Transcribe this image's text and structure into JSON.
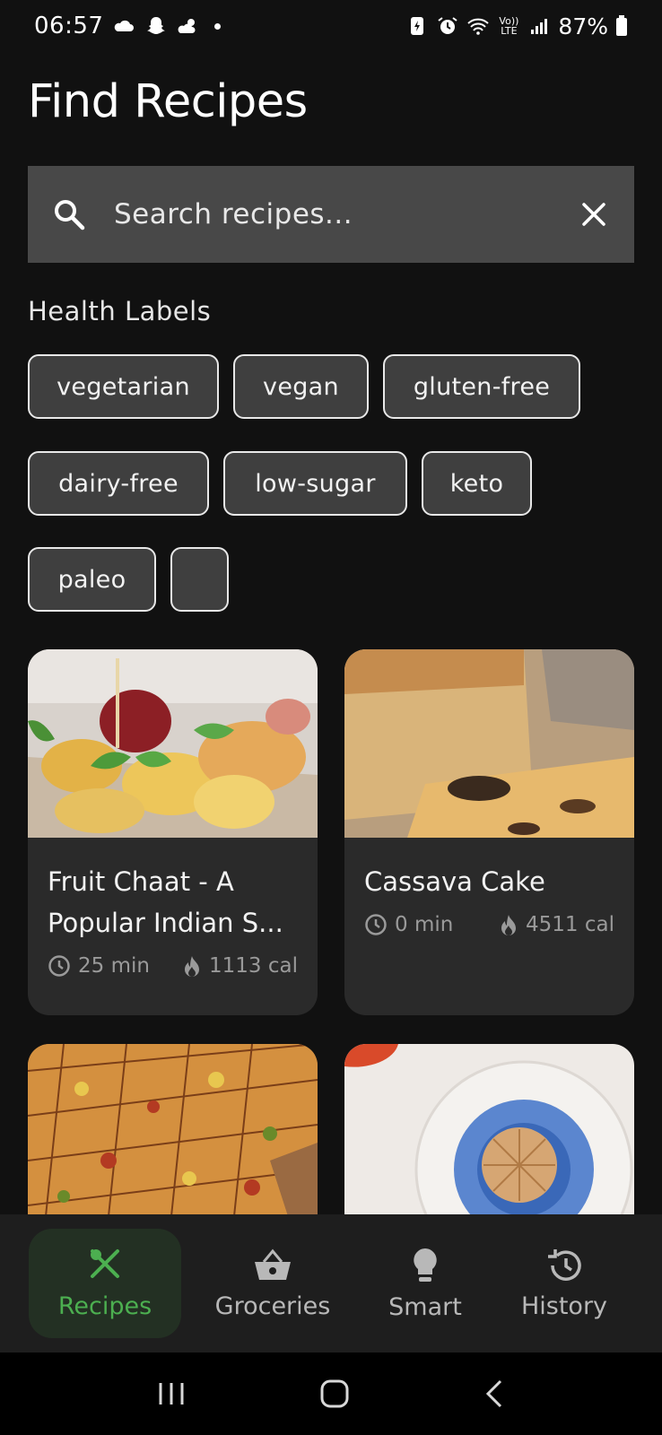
{
  "status_bar": {
    "time": "06:57",
    "battery": "87%",
    "network": "Vo)) LTE"
  },
  "page_title": "Find Recipes",
  "search": {
    "placeholder": "Search recipes..."
  },
  "health_labels": {
    "title": "Health Labels",
    "chips": [
      "vegetarian",
      "vegan",
      "gluten-free",
      "dairy-free",
      "low-sugar",
      "keto",
      "paleo",
      ""
    ]
  },
  "recipes": [
    {
      "title": "Fruit Chaat - A Popular Indian S...",
      "time": "25 min",
      "calories": "1113 cal"
    },
    {
      "title": "Cassava Cake",
      "time": "0 min",
      "calories": "4511 cal"
    }
  ],
  "bottom_nav": {
    "items": [
      {
        "label": "Recipes",
        "icon": "fork-knife-icon",
        "active": true
      },
      {
        "label": "Groceries",
        "icon": "basket-icon",
        "active": false
      },
      {
        "label": "Smart",
        "icon": "lightbulb-icon",
        "active": false
      },
      {
        "label": "History",
        "icon": "history-icon",
        "active": false
      }
    ]
  },
  "colors": {
    "background": "#111111",
    "surface": "#2a2a2a",
    "search_bg": "#484848",
    "accent": "#4caf50"
  }
}
